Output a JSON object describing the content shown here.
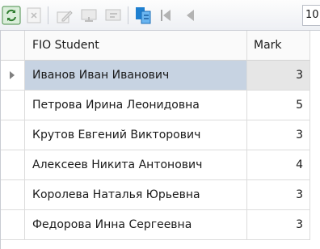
{
  "toolbar": {
    "page_number": "10",
    "buttons": [
      {
        "name": "refresh-icon",
        "color": "#3a8f3a"
      },
      {
        "name": "cancel-icon"
      },
      {
        "name": "edit-icon"
      },
      {
        "name": "post-icon"
      },
      {
        "name": "cancel-edit-icon"
      },
      {
        "name": "copy-icon",
        "color": "#1e7fd0"
      },
      {
        "name": "first-record-icon"
      },
      {
        "name": "prior-record-icon"
      }
    ]
  },
  "table": {
    "columns": [
      "FIO Student",
      "Mark"
    ],
    "rows": [
      {
        "name": "Иванов Иван Иванович",
        "mark": "3"
      },
      {
        "name": "Петрова Ирина Леонидовна",
        "mark": "5"
      },
      {
        "name": "Крутов Евгений Викторович",
        "mark": "3"
      },
      {
        "name": "Алексеев Никита Антонович",
        "mark": "4"
      },
      {
        "name": "Королева Наталья Юрьевна",
        "mark": "3"
      },
      {
        "name": "Федорова Инна Сергеевна",
        "mark": "3"
      }
    ],
    "selected_row": 0
  }
}
